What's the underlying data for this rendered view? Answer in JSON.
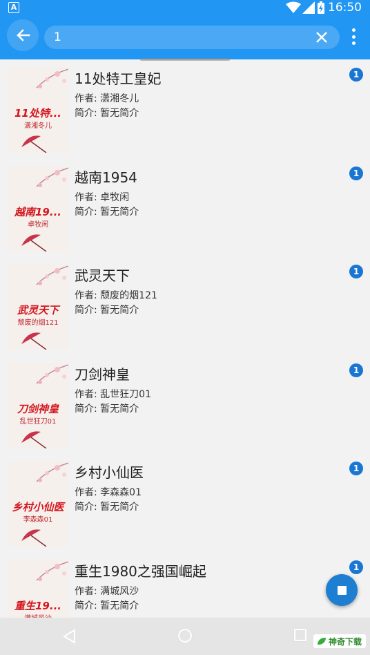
{
  "status_bar": {
    "time": "16:50",
    "app_icon_letter": "A"
  },
  "search": {
    "query": "1",
    "placeholder": ""
  },
  "books": [
    {
      "title": "11处特工皇妃",
      "author": "作者: 潇湘冬儿",
      "intro": "简介: 暂无简介",
      "badge": "1",
      "cover_title": "11处特...",
      "cover_author": "潇湘冬儿"
    },
    {
      "title": "越南1954",
      "author": "作者: 卓牧闲",
      "intro": "简介: 暂无简介",
      "badge": "1",
      "cover_title": "越南19...",
      "cover_author": "卓牧闲"
    },
    {
      "title": "武灵天下",
      "author": "作者: 颓废的烟121",
      "intro": "简介: 暂无简介",
      "badge": "1",
      "cover_title": "武灵天下",
      "cover_author": "颓废的烟121"
    },
    {
      "title": "刀剑神皇",
      "author": "作者: 乱世狂刀01",
      "intro": "简介: 暂无简介",
      "badge": "1",
      "cover_title": "刀剑神皇",
      "cover_author": "乱世狂刀01"
    },
    {
      "title": "乡村小仙医",
      "author": "作者: 李森森01",
      "intro": "简介: 暂无简介",
      "badge": "1",
      "cover_title": "乡村小仙医",
      "cover_author": "李森森01"
    },
    {
      "title": "重生1980之强国崛起",
      "author": "作者: 满城风沙",
      "intro": "简介: 暂无简介",
      "badge": "1",
      "cover_title": "重生19...",
      "cover_author": "满城风沙"
    }
  ],
  "watermark": "神奇下载",
  "colors": {
    "primary": "#2196f3",
    "badge": "#1976d2",
    "fab": "#1e7ed2",
    "cover_text": "#d4161f"
  },
  "icons": {
    "back": "arrow-left-icon",
    "clear": "close-icon",
    "more": "more-vert-icon",
    "fab": "stop-icon"
  }
}
